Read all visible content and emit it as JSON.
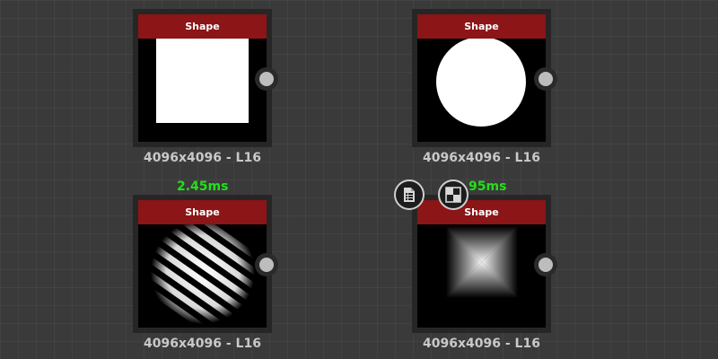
{
  "nodes": [
    {
      "title": "Shape",
      "resolution": "4096x4096 - L16",
      "preview": "square"
    },
    {
      "title": "Shape",
      "resolution": "4096x4096 - L16",
      "preview": "disc"
    },
    {
      "title": "Shape",
      "resolution": "4096x4096 - L16",
      "preview": "striped-sphere"
    },
    {
      "title": "Shape",
      "resolution": "4096x4096 - L16",
      "preview": "pyramid-gradient"
    }
  ],
  "timings": {
    "left": "2.45ms",
    "right": "95ms"
  },
  "toolbar": {
    "icons": [
      "document-list-icon",
      "checker-preview-icon"
    ]
  },
  "colors": {
    "header": "#8b1517",
    "timing": "#22e01a",
    "caption": "#c9c9c9"
  }
}
